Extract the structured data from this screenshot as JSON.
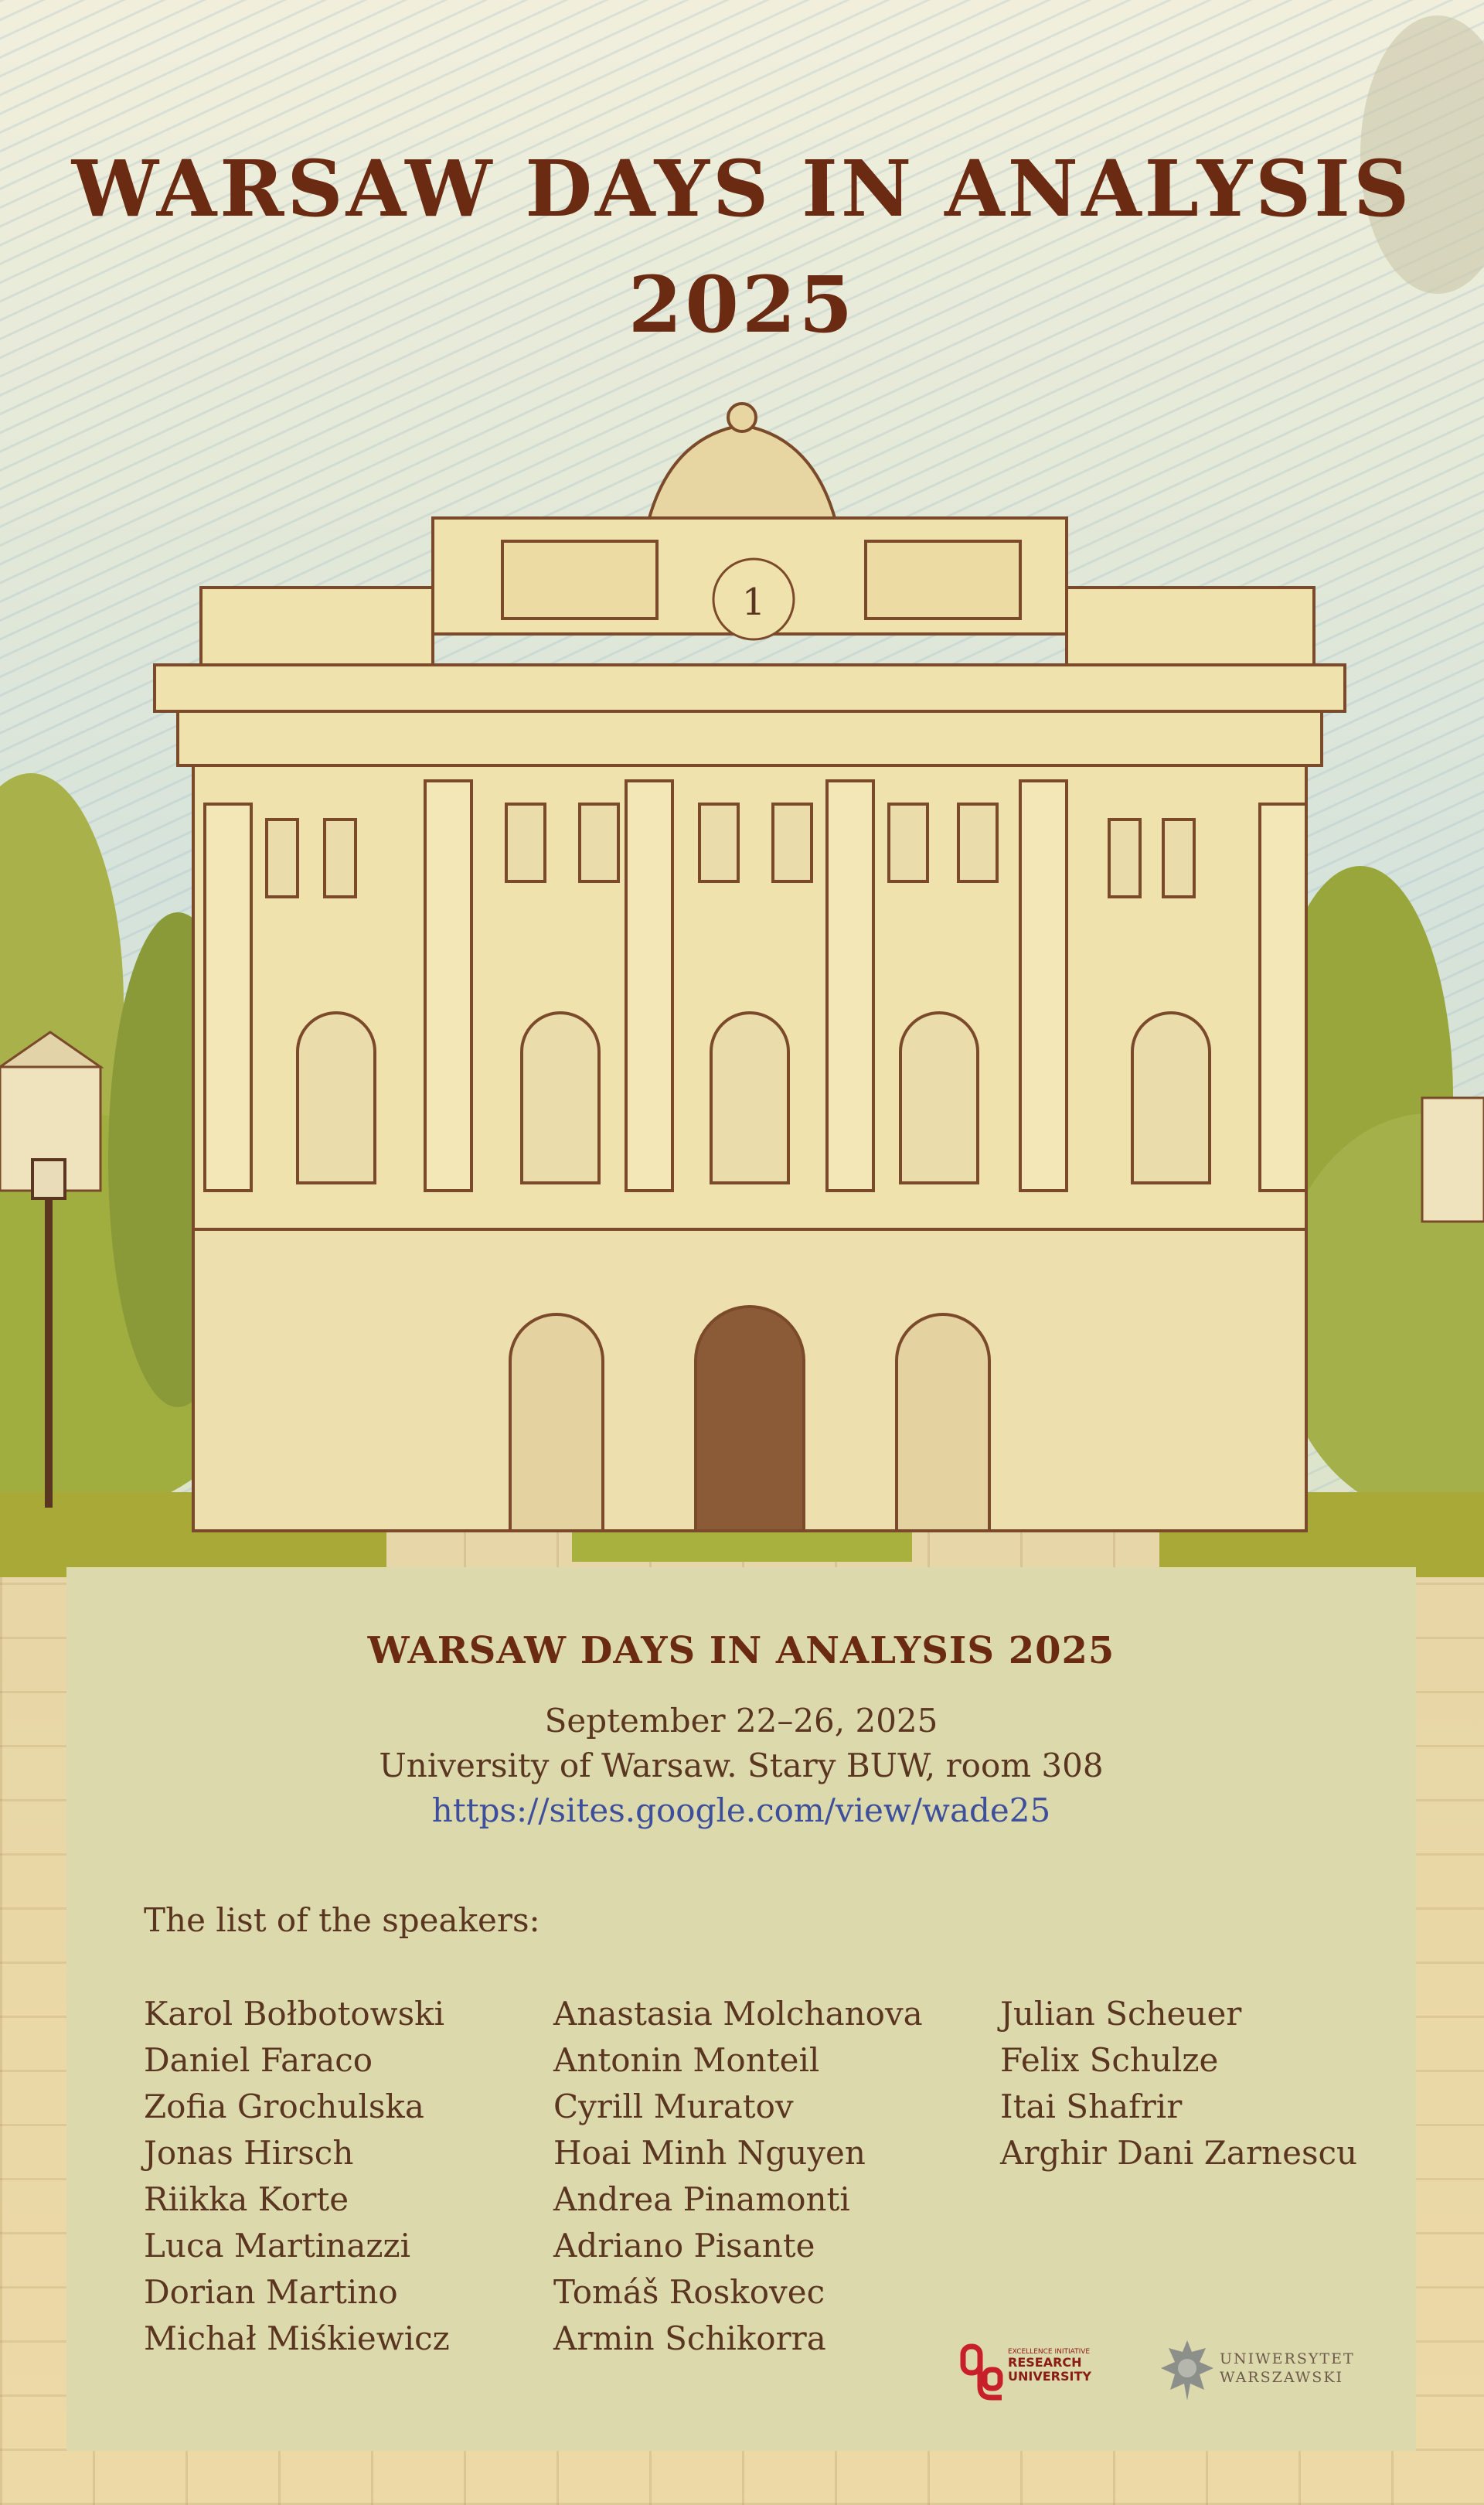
{
  "poster": {
    "title_line1": "WARSAW DAYS IN ANALYSIS",
    "title_line2": "2025"
  },
  "panel": {
    "title": "WARSAW DAYS IN ANALYSIS 2025",
    "date": "September 22–26, 2025",
    "venue": "University of Warsaw. Stary BUW, room 308",
    "url": "https://sites.google.com/view/wade25",
    "speakers_heading": "The list of the speakers:",
    "speakers_col1": [
      "Karol Bołbotowski",
      "Daniel Faraco",
      "Zofia Grochulska",
      "Jonas Hirsch",
      "Riikka Korte",
      "Luca Martinazzi",
      "Dorian Martino",
      "Michał Miśkiewicz"
    ],
    "speakers_col2": [
      "Anastasia Molchanova",
      "Antonin Monteil",
      "Cyrill Muratov",
      "Hoai Minh Nguyen",
      "Andrea Pinamonti",
      "Adriano Pisante",
      "Tomáš Roskovec",
      "Armin Schikorra"
    ],
    "speakers_col3": [
      "Julian Scheuer",
      "Felix Schulze",
      "Itai Shafrir",
      "Arghir Dani Zarnescu"
    ]
  },
  "logos": {
    "rru_small": "EXCELLENCE INITIATIVE",
    "rru_line1": "RESEARCH",
    "rru_line2": "UNIVERSITY",
    "uw_line1": "UNIWERSYTET",
    "uw_line2": "WARSZAWSKI"
  },
  "colors": {
    "title": "#6b2a12",
    "text": "#5a3520",
    "link": "#3d4f9c",
    "panel": "#dcd9ad"
  },
  "clock": {
    "digit": "1"
  }
}
